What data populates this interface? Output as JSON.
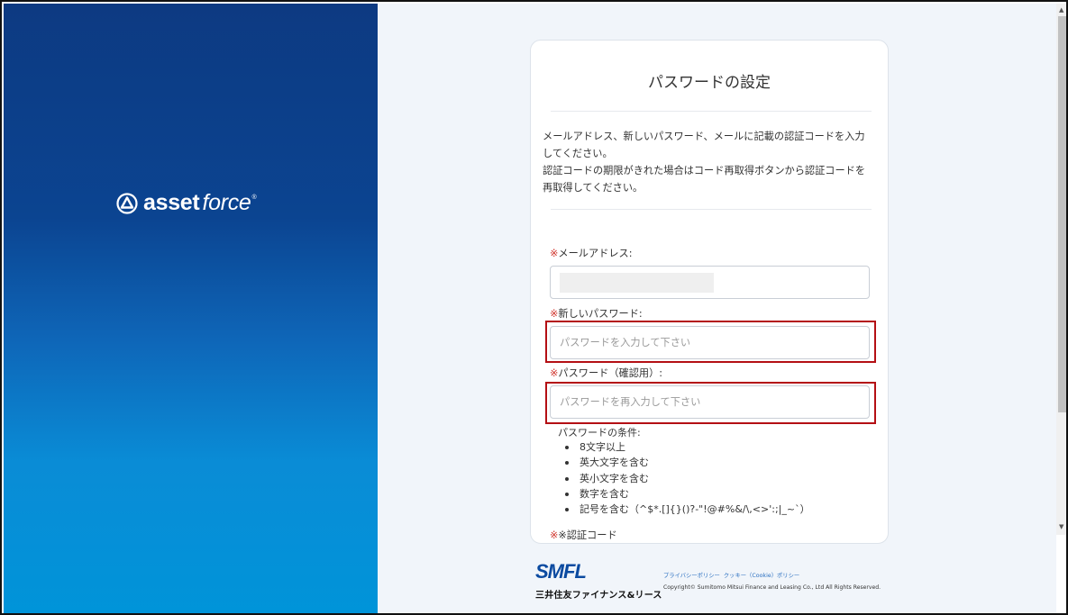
{
  "brand": {
    "logo_text_bold": "asset",
    "logo_text_light": "force",
    "logo_mark": "®"
  },
  "form": {
    "title": "パスワードの設定",
    "description": [
      "メールアドレス、新しいパスワード、メールに記載の認証コードを入力",
      "してください。",
      "認証コードの期限がきれた場合はコード再取得ボタンから認証コードを",
      "再取得してください。"
    ],
    "required_mark": "※",
    "email": {
      "label": "メールアドレス:",
      "value": ""
    },
    "new_password": {
      "label": "新しいパスワード:",
      "placeholder": "パスワードを入力して下さい"
    },
    "confirm_password": {
      "label": "パスワード（確認用）:",
      "placeholder": "パスワードを再入力して下さい"
    },
    "conditions": {
      "title": "パスワードの条件:",
      "items": [
        "8文字以上",
        "英大文字を含む",
        "英小文字を含む",
        "数字を含む",
        "記号を含む（^$*.[]{}()?-\"!@#%&/\\,<>':;|_~`）"
      ]
    },
    "next_label_partial": "※認証コード"
  },
  "footer": {
    "logo": "SMFL",
    "company_name": "三井住友ファイナンス&リース",
    "links": [
      "プライバシーポリシー",
      "クッキー（Cookie）ポリシー"
    ],
    "copyright": "Copyright© Sumitomo Mitsui Finance and Leasing Co., Ltd All Rights Reserved."
  },
  "colors": {
    "accent_blue": "#0b4aa0",
    "required_red": "#d0342c",
    "highlight_red": "#b40f14",
    "panel_dark": "#0d3a82",
    "panel_light": "#0094d9"
  }
}
